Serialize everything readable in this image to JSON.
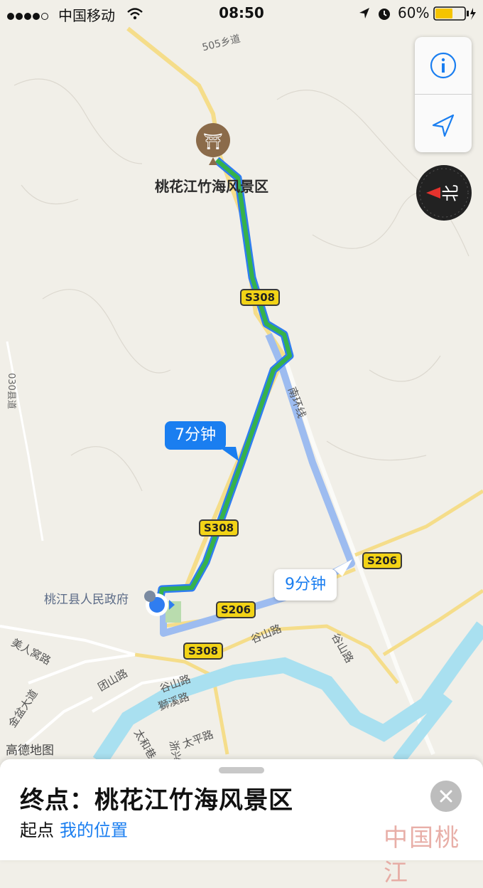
{
  "status_bar": {
    "carrier": "中国移动",
    "time": "08:50",
    "battery_percent": "60%",
    "signal_bars_filled": 4,
    "signal_bars_total": 5,
    "battery_level": 0.6
  },
  "map": {
    "poi_label": "桃花江竹海风景区",
    "government_label": "桃江县人民政府",
    "provider_label": "高德地图",
    "road_labels": {
      "township_505": "505乡道",
      "county_030": "030县道",
      "south_ring": "南环线",
      "guoshan_1": "谷山路",
      "guoshan_2": "谷山路",
      "guoshan_3": "谷山路",
      "tuanshan": "团山路",
      "meirenwo": "美人窝路",
      "jinpen": "金盆大道",
      "shixi": "獅溪路",
      "taihe": "太和巷",
      "taiping": "太平路",
      "xingshi": "浙兴"
    },
    "shields": {
      "s308_a": "S308",
      "s308_b": "S308",
      "s308_c": "S308",
      "s206_a": "S206",
      "s206_b": "S206"
    },
    "route_primary_time": "7分钟",
    "route_alt_time": "9分钟",
    "colors": {
      "primary_route": "#36b24a",
      "route_outline": "#2f7df0",
      "alt_route": "#9dbcf0",
      "river": "#a9e0f0",
      "callout_blue": "#1a7ef0"
    }
  },
  "controls": {
    "info_icon": "info-icon",
    "locate_icon": "location-arrow-icon",
    "compass_label": "北"
  },
  "bottom_sheet": {
    "destination_label": "终点：",
    "destination_name": "桃花江竹海风景区",
    "start_label": "起点",
    "start_value": "我的位置"
  },
  "watermark": "中国桃江"
}
